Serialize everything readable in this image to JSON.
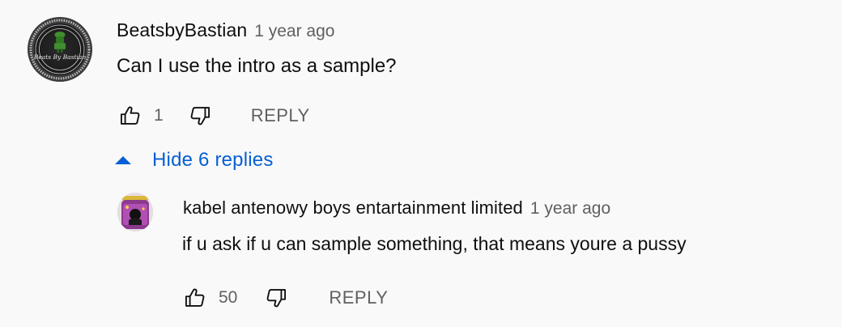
{
  "comment": {
    "author": "BeatsbyBastian",
    "time": "1 year ago",
    "text": "Can I use the intro as a sample?",
    "avatar_icon": "beats-by-bastian-logo",
    "avatar_logo_text": "Beats By Bastian",
    "like_count": "1",
    "reply_label": "REPLY",
    "like_icon": "thumbs-up-icon",
    "dislike_icon": "thumbs-down-icon"
  },
  "replies_toggle": {
    "label": "Hide 6 replies",
    "icon": "caret-up-icon",
    "color": "#065fd4"
  },
  "reply": {
    "author": "kabel antenowy boys entartainment limited",
    "time": "1 year ago",
    "text": "if u ask if u can sample something, that means youre a pussy",
    "avatar_icon": "purple-jar-avatar",
    "like_count": "50",
    "reply_label": "REPLY"
  },
  "colors": {
    "background": "#f9f9f9",
    "text": "#0f0f0f",
    "secondary": "#606060",
    "link": "#065fd4"
  }
}
